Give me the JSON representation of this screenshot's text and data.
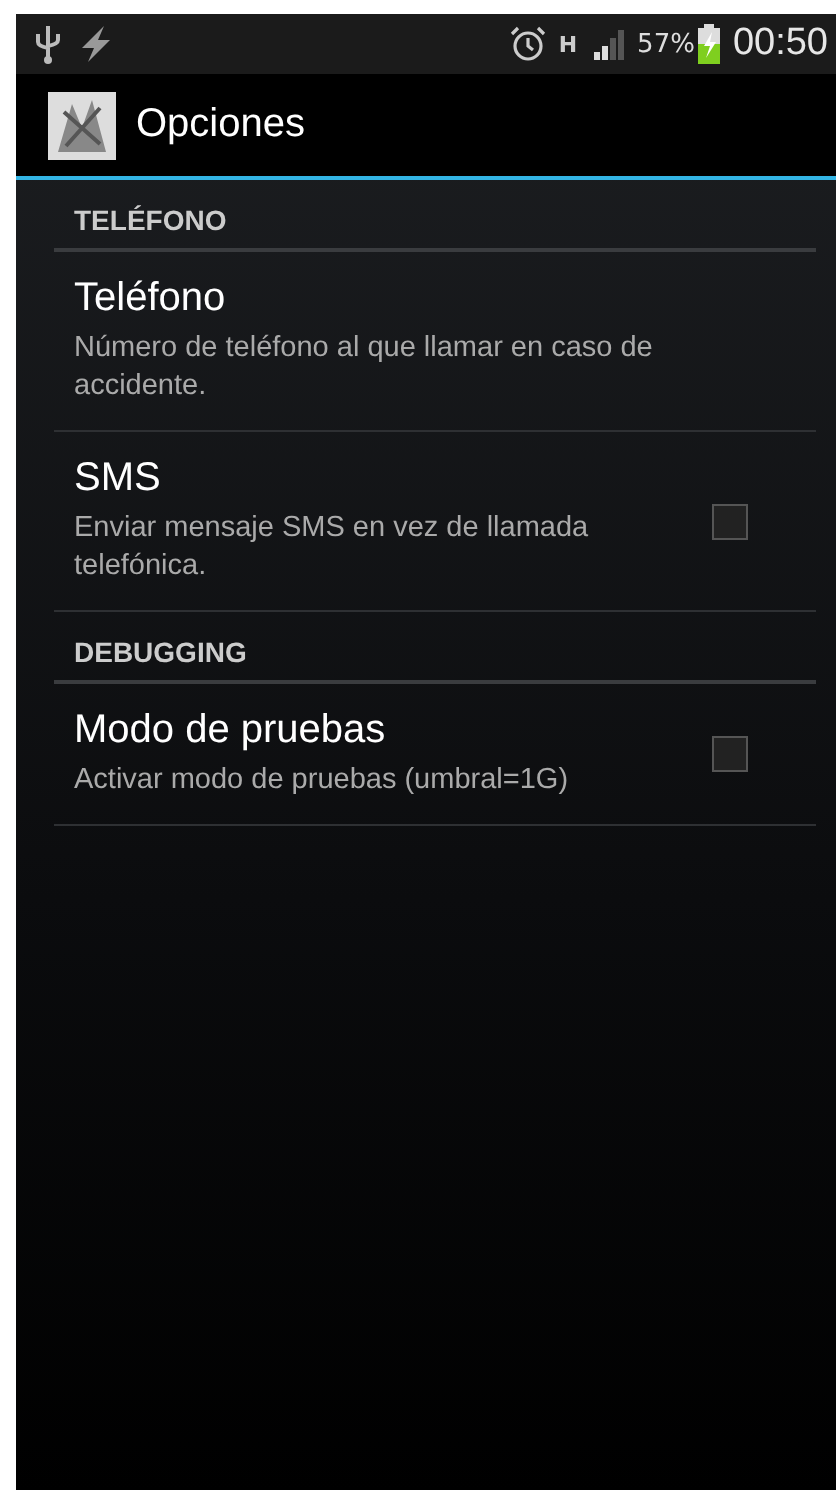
{
  "status_bar": {
    "network_type": "H",
    "battery_percent": "57%",
    "time": "00:50"
  },
  "action_bar": {
    "title": "Opciones"
  },
  "preferences": [
    {
      "kind": "category",
      "title": "TELÉFONO"
    },
    {
      "kind": "text",
      "title": "Teléfono",
      "summary": "Número de teléfono al que llamar en caso de accidente."
    },
    {
      "kind": "checkbox",
      "title": "SMS",
      "summary": "Enviar mensaje SMS en vez de llamada telefónica.",
      "checked": false
    },
    {
      "kind": "category",
      "title": "DEBUGGING"
    },
    {
      "kind": "checkbox",
      "title": "Modo de pruebas",
      "summary": "Activar modo de pruebas (umbral=1G)",
      "checked": false
    }
  ]
}
